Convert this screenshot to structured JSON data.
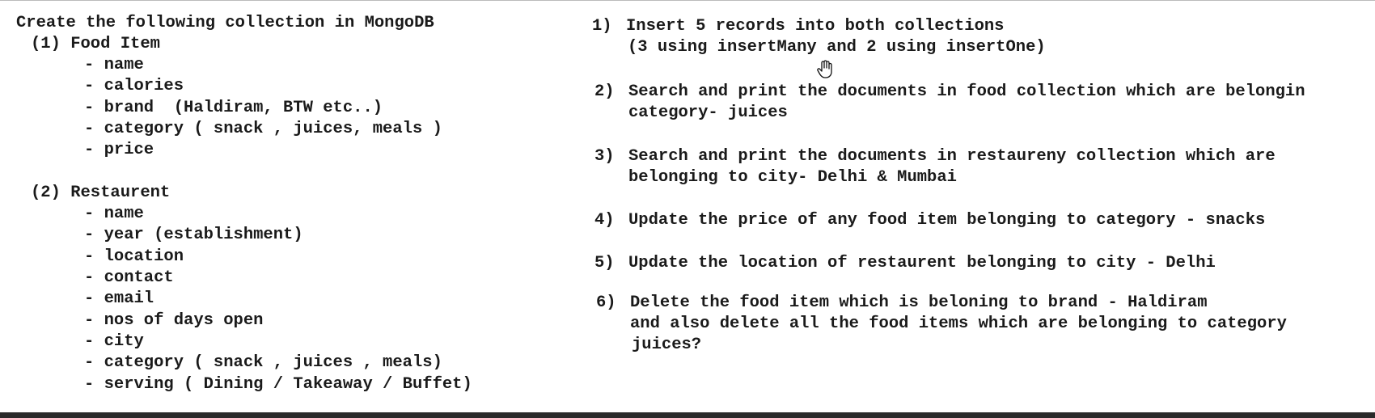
{
  "left": {
    "heading": "Create the following collection in MongoDB",
    "food": {
      "title": "(1) Food Item",
      "fields": [
        "- name",
        "- calories",
        "- brand  (Haldiram, BTW etc..)",
        "- category ( snack , juices, meals )",
        "- price"
      ]
    },
    "restaurent": {
      "title": "(2) Restaurent",
      "fields": [
        "- name",
        "- year (establishment)",
        "- location",
        "- contact",
        "- email",
        "- nos of days open",
        "- city",
        "- category ( snack , juices , meals)",
        "- serving ( Dining / Takeaway / Buffet)"
      ]
    }
  },
  "right": {
    "tasks": [
      {
        "num": "1)",
        "lines": [
          "Insert 5 records into both collections",
          "(3 using insertMany and 2 using insertOne)"
        ]
      },
      {
        "num": "2)",
        "lines": [
          "Search and print the documents in food collection which are belongin",
          "category- juices"
        ]
      },
      {
        "num": "3)",
        "lines": [
          "Search and print the documents in restaureny collection which are",
          "belonging to city- Delhi & Mumbai"
        ]
      },
      {
        "num": "4)",
        "lines": [
          "Update the price of any food item belonging to category - snacks"
        ]
      },
      {
        "num": "5)",
        "lines": [
          "Update the location of restaurent belonging to city - Delhi"
        ]
      },
      {
        "num": "6)",
        "lines": [
          "Delete the food item which is beloning to brand - Haldiram",
          "and also delete all the food items which are belonging to category",
          "juices?"
        ]
      }
    ]
  },
  "icons": {
    "cursor": "hand-pointer-icon"
  }
}
